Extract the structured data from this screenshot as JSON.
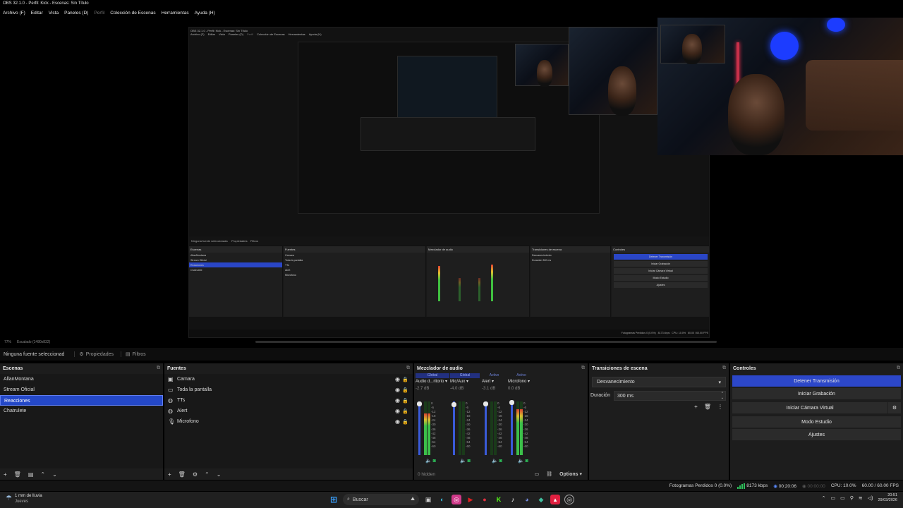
{
  "window": {
    "title": "OBS 32.1.0 - Perfil: Kick - Escenas: Sin Título"
  },
  "menu": [
    {
      "label": "Archivo (F)",
      "dim": false
    },
    {
      "label": "Editar",
      "dim": false
    },
    {
      "label": "Vista",
      "dim": false
    },
    {
      "label": "Paneles (D)",
      "dim": false
    },
    {
      "label": "Perfil",
      "dim": true
    },
    {
      "label": "Colección de Escenas",
      "dim": false
    },
    {
      "label": "Herramientas",
      "dim": false
    },
    {
      "label": "Ayuda (H)",
      "dim": false
    }
  ],
  "preview": {
    "zoom": "77%",
    "scale_label": "Escalado (1480x832)"
  },
  "source_toolbar": {
    "no_source": "Ninguna fuente seleccionad",
    "properties": "Propiedades",
    "filters": "Filtros"
  },
  "scenes": {
    "title": "Escenas",
    "items": [
      "AllanMontana",
      "Stream Oficial",
      "Reacciones",
      "Chatrulete"
    ],
    "selected_index": 2
  },
  "sources": {
    "title": "Fuentes",
    "items": [
      {
        "label": "Camara",
        "icon": "camera-icon"
      },
      {
        "label": "Toda la pantalla",
        "icon": "monitor-icon"
      },
      {
        "label": "TTs",
        "icon": "globe-icon"
      },
      {
        "label": "Alert",
        "icon": "globe-icon"
      },
      {
        "label": "Microfono",
        "icon": "microphone-icon"
      }
    ]
  },
  "mixer": {
    "title": "Mezclador de audio",
    "channels": [
      {
        "tag": "Global",
        "tag_active": false,
        "name": "Audio d...ritorio",
        "db": "-2.7 dB",
        "level": 0.78,
        "fader": 0.98
      },
      {
        "tag": "Global",
        "tag_active": false,
        "name": "Mic/Aux",
        "db": "-4.0 dB",
        "level": 0.0,
        "fader": 0.96
      },
      {
        "tag": "Activo",
        "tag_active": true,
        "name": "Alert",
        "db": "-3.1 dB",
        "level": 0.0,
        "fader": 0.97
      },
      {
        "tag": "Activo",
        "tag_active": true,
        "name": "Microfono",
        "db": "0.0 dB",
        "level": 0.86,
        "fader": 1.0
      }
    ],
    "scale": [
      "0",
      "-6",
      "-12",
      "-18",
      "-24",
      "-30",
      "-36",
      "-42",
      "-48",
      "-54",
      "-60"
    ],
    "hidden": "0 hidden",
    "options": "Options"
  },
  "transitions": {
    "title": "Transiciones de escena",
    "selected": "Desvanecimiento",
    "duration_label": "Duración",
    "duration_value": "300 ms"
  },
  "controls": {
    "title": "Controles",
    "buttons": [
      "Detener Transmisión",
      "Iniciar Grabación",
      "Iniciar Cámara Virtual",
      "Modo Estudio",
      "Ajustes"
    ]
  },
  "status": {
    "dropped": "Fotogramas Perdidos 0 (0.0%)",
    "bitrate": "8173 kbps",
    "stream_time": "00:20:06",
    "rec_time": "00:00:00",
    "cpu": "CPU: 10.0%",
    "fps": "60.00 / 60.00 FPS"
  },
  "taskbar": {
    "weather_line1": "1 mm de lluvia",
    "weather_line2": "Jueves",
    "search": "Buscar",
    "time": "20:51",
    "date": "29/03/2026"
  },
  "colors": {
    "accent": "#2c47c9",
    "meter_green": "#3cc04a",
    "headphone_green": "#2dc05a"
  }
}
